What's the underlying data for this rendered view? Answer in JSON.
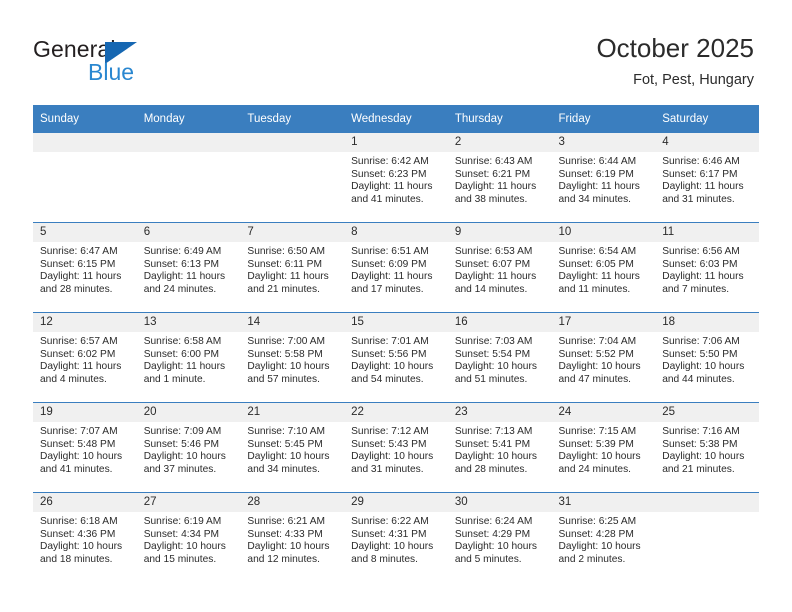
{
  "brand": {
    "name_top": "General",
    "name_bottom": "Blue",
    "accent_color": "#2a87d0",
    "triangle_color": "#1667b2"
  },
  "header": {
    "title": "October 2025",
    "location": "Fot, Pest, Hungary"
  },
  "theme": {
    "header_blue": "#3a7ebf",
    "daynum_band": "#f0f0f0",
    "text": "#2b2b2b"
  },
  "weekday_headers": [
    "Sunday",
    "Monday",
    "Tuesday",
    "Wednesday",
    "Thursday",
    "Friday",
    "Saturday"
  ],
  "weeks": [
    [
      {
        "day": "",
        "sunrise": "",
        "sunset": "",
        "daylight1": "",
        "daylight2": "",
        "empty": true
      },
      {
        "day": "",
        "sunrise": "",
        "sunset": "",
        "daylight1": "",
        "daylight2": "",
        "empty": true
      },
      {
        "day": "",
        "sunrise": "",
        "sunset": "",
        "daylight1": "",
        "daylight2": "",
        "empty": true
      },
      {
        "day": "1",
        "sunrise": "Sunrise: 6:42 AM",
        "sunset": "Sunset: 6:23 PM",
        "daylight1": "Daylight: 11 hours",
        "daylight2": "and 41 minutes."
      },
      {
        "day": "2",
        "sunrise": "Sunrise: 6:43 AM",
        "sunset": "Sunset: 6:21 PM",
        "daylight1": "Daylight: 11 hours",
        "daylight2": "and 38 minutes."
      },
      {
        "day": "3",
        "sunrise": "Sunrise: 6:44 AM",
        "sunset": "Sunset: 6:19 PM",
        "daylight1": "Daylight: 11 hours",
        "daylight2": "and 34 minutes."
      },
      {
        "day": "4",
        "sunrise": "Sunrise: 6:46 AM",
        "sunset": "Sunset: 6:17 PM",
        "daylight1": "Daylight: 11 hours",
        "daylight2": "and 31 minutes."
      }
    ],
    [
      {
        "day": "5",
        "sunrise": "Sunrise: 6:47 AM",
        "sunset": "Sunset: 6:15 PM",
        "daylight1": "Daylight: 11 hours",
        "daylight2": "and 28 minutes."
      },
      {
        "day": "6",
        "sunrise": "Sunrise: 6:49 AM",
        "sunset": "Sunset: 6:13 PM",
        "daylight1": "Daylight: 11 hours",
        "daylight2": "and 24 minutes."
      },
      {
        "day": "7",
        "sunrise": "Sunrise: 6:50 AM",
        "sunset": "Sunset: 6:11 PM",
        "daylight1": "Daylight: 11 hours",
        "daylight2": "and 21 minutes."
      },
      {
        "day": "8",
        "sunrise": "Sunrise: 6:51 AM",
        "sunset": "Sunset: 6:09 PM",
        "daylight1": "Daylight: 11 hours",
        "daylight2": "and 17 minutes."
      },
      {
        "day": "9",
        "sunrise": "Sunrise: 6:53 AM",
        "sunset": "Sunset: 6:07 PM",
        "daylight1": "Daylight: 11 hours",
        "daylight2": "and 14 minutes."
      },
      {
        "day": "10",
        "sunrise": "Sunrise: 6:54 AM",
        "sunset": "Sunset: 6:05 PM",
        "daylight1": "Daylight: 11 hours",
        "daylight2": "and 11 minutes."
      },
      {
        "day": "11",
        "sunrise": "Sunrise: 6:56 AM",
        "sunset": "Sunset: 6:03 PM",
        "daylight1": "Daylight: 11 hours",
        "daylight2": "and 7 minutes."
      }
    ],
    [
      {
        "day": "12",
        "sunrise": "Sunrise: 6:57 AM",
        "sunset": "Sunset: 6:02 PM",
        "daylight1": "Daylight: 11 hours",
        "daylight2": "and 4 minutes."
      },
      {
        "day": "13",
        "sunrise": "Sunrise: 6:58 AM",
        "sunset": "Sunset: 6:00 PM",
        "daylight1": "Daylight: 11 hours",
        "daylight2": "and 1 minute."
      },
      {
        "day": "14",
        "sunrise": "Sunrise: 7:00 AM",
        "sunset": "Sunset: 5:58 PM",
        "daylight1": "Daylight: 10 hours",
        "daylight2": "and 57 minutes."
      },
      {
        "day": "15",
        "sunrise": "Sunrise: 7:01 AM",
        "sunset": "Sunset: 5:56 PM",
        "daylight1": "Daylight: 10 hours",
        "daylight2": "and 54 minutes."
      },
      {
        "day": "16",
        "sunrise": "Sunrise: 7:03 AM",
        "sunset": "Sunset: 5:54 PM",
        "daylight1": "Daylight: 10 hours",
        "daylight2": "and 51 minutes."
      },
      {
        "day": "17",
        "sunrise": "Sunrise: 7:04 AM",
        "sunset": "Sunset: 5:52 PM",
        "daylight1": "Daylight: 10 hours",
        "daylight2": "and 47 minutes."
      },
      {
        "day": "18",
        "sunrise": "Sunrise: 7:06 AM",
        "sunset": "Sunset: 5:50 PM",
        "daylight1": "Daylight: 10 hours",
        "daylight2": "and 44 minutes."
      }
    ],
    [
      {
        "day": "19",
        "sunrise": "Sunrise: 7:07 AM",
        "sunset": "Sunset: 5:48 PM",
        "daylight1": "Daylight: 10 hours",
        "daylight2": "and 41 minutes."
      },
      {
        "day": "20",
        "sunrise": "Sunrise: 7:09 AM",
        "sunset": "Sunset: 5:46 PM",
        "daylight1": "Daylight: 10 hours",
        "daylight2": "and 37 minutes."
      },
      {
        "day": "21",
        "sunrise": "Sunrise: 7:10 AM",
        "sunset": "Sunset: 5:45 PM",
        "daylight1": "Daylight: 10 hours",
        "daylight2": "and 34 minutes."
      },
      {
        "day": "22",
        "sunrise": "Sunrise: 7:12 AM",
        "sunset": "Sunset: 5:43 PM",
        "daylight1": "Daylight: 10 hours",
        "daylight2": "and 31 minutes."
      },
      {
        "day": "23",
        "sunrise": "Sunrise: 7:13 AM",
        "sunset": "Sunset: 5:41 PM",
        "daylight1": "Daylight: 10 hours",
        "daylight2": "and 28 minutes."
      },
      {
        "day": "24",
        "sunrise": "Sunrise: 7:15 AM",
        "sunset": "Sunset: 5:39 PM",
        "daylight1": "Daylight: 10 hours",
        "daylight2": "and 24 minutes."
      },
      {
        "day": "25",
        "sunrise": "Sunrise: 7:16 AM",
        "sunset": "Sunset: 5:38 PM",
        "daylight1": "Daylight: 10 hours",
        "daylight2": "and 21 minutes."
      }
    ],
    [
      {
        "day": "26",
        "sunrise": "Sunrise: 6:18 AM",
        "sunset": "Sunset: 4:36 PM",
        "daylight1": "Daylight: 10 hours",
        "daylight2": "and 18 minutes."
      },
      {
        "day": "27",
        "sunrise": "Sunrise: 6:19 AM",
        "sunset": "Sunset: 4:34 PM",
        "daylight1": "Daylight: 10 hours",
        "daylight2": "and 15 minutes."
      },
      {
        "day": "28",
        "sunrise": "Sunrise: 6:21 AM",
        "sunset": "Sunset: 4:33 PM",
        "daylight1": "Daylight: 10 hours",
        "daylight2": "and 12 minutes."
      },
      {
        "day": "29",
        "sunrise": "Sunrise: 6:22 AM",
        "sunset": "Sunset: 4:31 PM",
        "daylight1": "Daylight: 10 hours",
        "daylight2": "and 8 minutes."
      },
      {
        "day": "30",
        "sunrise": "Sunrise: 6:24 AM",
        "sunset": "Sunset: 4:29 PM",
        "daylight1": "Daylight: 10 hours",
        "daylight2": "and 5 minutes."
      },
      {
        "day": "31",
        "sunrise": "Sunrise: 6:25 AM",
        "sunset": "Sunset: 4:28 PM",
        "daylight1": "Daylight: 10 hours",
        "daylight2": "and 2 minutes."
      },
      {
        "day": "",
        "sunrise": "",
        "sunset": "",
        "daylight1": "",
        "daylight2": "",
        "empty": true
      }
    ]
  ]
}
